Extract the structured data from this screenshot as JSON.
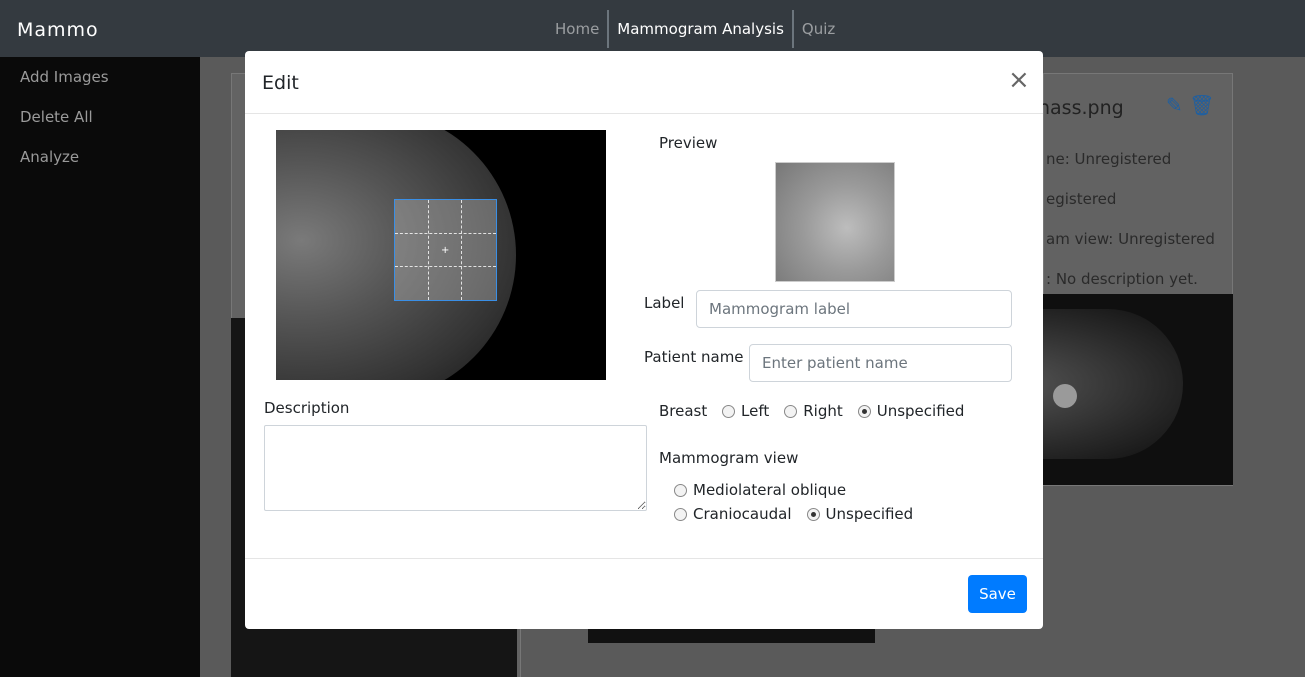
{
  "navbar": {
    "brand": "Mammo",
    "links": [
      {
        "label": "Home"
      },
      {
        "label": "Mammogram Analysis"
      },
      {
        "label": "Quiz"
      }
    ]
  },
  "sidebar": {
    "items": [
      {
        "label": "Add Images"
      },
      {
        "label": "Delete All"
      },
      {
        "label": "Analyze"
      }
    ]
  },
  "background_card": {
    "title_fragment": "nass.png",
    "lines": [
      "ne: Unregistered",
      "egistered",
      "am view: Unregistered",
      ": No description yet."
    ]
  },
  "modal": {
    "title": "Edit",
    "close_symbol": "×",
    "preview_label": "Preview",
    "label_field": {
      "label": "Label",
      "placeholder": "Mammogram label",
      "value": ""
    },
    "patient_field": {
      "label": "Patient name",
      "placeholder": "Enter patient name",
      "value": ""
    },
    "description": {
      "label": "Description",
      "value": ""
    },
    "breast": {
      "label": "Breast",
      "options": [
        "Left",
        "Right",
        "Unspecified"
      ],
      "selected": "Unspecified"
    },
    "view": {
      "label": "Mammogram view",
      "options": [
        "Mediolateral oblique",
        "Craniocaudal",
        "Unspecified"
      ],
      "selected": "Unspecified"
    },
    "save_label": "Save"
  },
  "colors": {
    "navbar_bg": "#343a40",
    "primary": "#007bff",
    "crop_border": "#3a8fe6"
  }
}
